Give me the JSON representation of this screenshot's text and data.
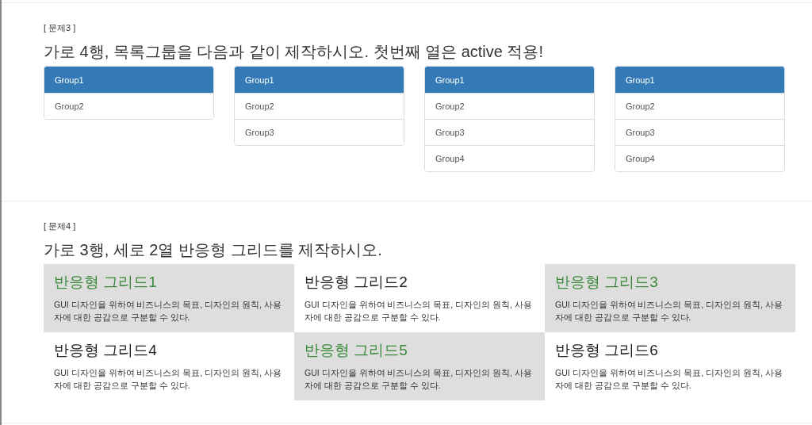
{
  "section_3": {
    "label": "[ 문제3 ]",
    "heading": "가로 4행, 목록그룹을 다음과 같이 제작하시오. 첫번째 열은 active 적용!",
    "list_groups": [
      {
        "items": [
          {
            "label": "Group1",
            "selected": true
          },
          {
            "label": "Group2",
            "selected": false
          }
        ]
      },
      {
        "items": [
          {
            "label": "Group1",
            "selected": true
          },
          {
            "label": "Group2",
            "selected": false
          },
          {
            "label": "Group3",
            "selected": false
          }
        ]
      },
      {
        "items": [
          {
            "label": "Group1",
            "selected": true
          },
          {
            "label": "Group2",
            "selected": false
          },
          {
            "label": "Group3",
            "selected": false
          },
          {
            "label": "Group4",
            "selected": false
          }
        ]
      },
      {
        "items": [
          {
            "label": "Group1",
            "selected": true
          },
          {
            "label": "Group2",
            "selected": false
          },
          {
            "label": "Group3",
            "selected": false
          },
          {
            "label": "Group4",
            "selected": false
          }
        ]
      }
    ]
  },
  "section_4": {
    "label": "[ 문제4 ]",
    "heading": "가로 3행, 세로 2열 반응형 그리드를 제작하시오.",
    "cells": [
      {
        "title": "반응형 그리드1",
        "text": "GUI 디자인을 위하여 비즈니스의 목표, 디자인의 원칙, 사용자에 대한 공감으로 구분할 수 있다.",
        "shaded": true
      },
      {
        "title": "반응형 그리드2",
        "text": "GUI 디자인을 위하여 비즈니스의 목표, 디자인의 원칙, 사용자에 대한 공감으로 구분할 수 있다.",
        "shaded": false
      },
      {
        "title": "반응형 그리드3",
        "text": "GUI 디자인을 위하여 비즈니스의 목표, 디자인의 원칙, 사용자에 대한 공감으로 구분할 수 있다.",
        "shaded": true
      },
      {
        "title": "반응형 그리드4",
        "text": "GUI 디자인을 위하여 비즈니스의 목표, 디자인의 원칙, 사용자에 대한 공감으로 구분할 수 있다.",
        "shaded": false
      },
      {
        "title": "반응형 그리드5",
        "text": "GUI 디자인을 위하여 비즈니스의 목표, 디자인의 원칙, 사용자에 대한 공감으로 구분할 수 있다.",
        "shaded": true
      },
      {
        "title": "반응형 그리드6",
        "text": "GUI 디자인을 위하여 비즈니스의 목표, 디자인의 원칙, 사용자에 대한 공감으로 구분할 수 있다.",
        "shaded": false
      }
    ]
  }
}
